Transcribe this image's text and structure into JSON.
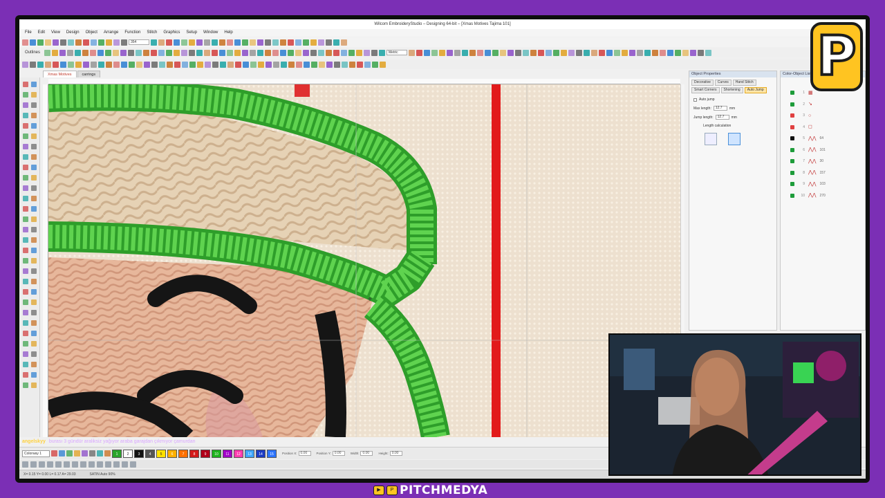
{
  "window": {
    "title": "Wilcom EmbroideryStudio – Designing 64-bit – [Xmas Motives   Tajima 101]"
  },
  "menu": [
    "File",
    "Edit",
    "View",
    "Design",
    "Object",
    "Arrange",
    "Function",
    "Stitch",
    "Graphics",
    "Setup",
    "Window",
    "Help"
  ],
  "toolbar": {
    "outlines_label": "Outlines",
    "zoom_value": "354",
    "units_value": "Metric"
  },
  "doc_tabs": [
    {
      "label": "Xmas Motives",
      "active": true
    },
    {
      "label": "carrings",
      "active": false
    }
  ],
  "object_properties": {
    "title": "Object Properties",
    "tabs": [
      "Decorative",
      "Curves",
      "Hand Stitch",
      "Smart Corners",
      "Shortening",
      "Auto Jump"
    ],
    "active_tab": "Auto Jump",
    "auto_jump_label": "Auto jump",
    "max_length_label": "Max length:",
    "max_length_value": "12.7",
    "jump_length_label": "Jump length:",
    "jump_length_value": "12.7",
    "unit": "mm",
    "length_calculation_label": "Length calculation"
  },
  "color_objects": {
    "title": "Color-Object List",
    "rows": [
      {
        "num": "1",
        "icon": "square-icon",
        "color": "#1e9c3a",
        "value": ""
      },
      {
        "num": "2",
        "icon": "pointer-icon",
        "color": "#1e9c3a",
        "value": ""
      },
      {
        "num": "3",
        "icon": "circle-icon",
        "color": "#e04040",
        "value": ""
      },
      {
        "num": "4",
        "icon": "outline-icon",
        "color": "#e04040",
        "value": ""
      },
      {
        "num": "5",
        "icon": "stitch-icon",
        "color": "#111111",
        "value": "64"
      },
      {
        "num": "6",
        "icon": "stitch-icon",
        "color": "#1e9c3a",
        "value": "101"
      },
      {
        "num": "7",
        "icon": "stitch-icon",
        "color": "#1e9c3a",
        "value": "30"
      },
      {
        "num": "8",
        "icon": "stitch-icon",
        "color": "#1e9c3a",
        "value": "157"
      },
      {
        "num": "9",
        "icon": "stitch-icon",
        "color": "#1e9c3a",
        "value": "103"
      },
      {
        "num": "10",
        "icon": "stitch-icon",
        "color": "#1e9c3a",
        "value": "270"
      }
    ]
  },
  "chat": {
    "user": "angelskyy",
    "message": "burası 3 gündür araliksiz yağıyor araba garajdan çıkmıyor çamurdan"
  },
  "bottom": {
    "colorway": "Colorway 1",
    "palette": [
      {
        "num": "1",
        "color": "#2aa52a"
      },
      {
        "num": "2",
        "color": "#ffffff"
      },
      {
        "num": "3",
        "color": "#111111"
      },
      {
        "num": "4",
        "color": "#555555"
      },
      {
        "num": "5",
        "color": "#ffe100"
      },
      {
        "num": "6",
        "color": "#ffb000"
      },
      {
        "num": "7",
        "color": "#ff7000"
      },
      {
        "num": "8",
        "color": "#d41c1c"
      },
      {
        "num": "9",
        "color": "#b0001a"
      },
      {
        "num": "10",
        "color": "#1db31d"
      },
      {
        "num": "11",
        "color": "#a000c8"
      },
      {
        "num": "12",
        "color": "#ff3cae"
      },
      {
        "num": "13",
        "color": "#3fa6ff"
      },
      {
        "num": "14",
        "color": "#1c3cc4"
      },
      {
        "num": "15",
        "color": "#2c74ff"
      }
    ],
    "position_x_label": "Position X:",
    "position_x_value": "0.00",
    "position_y_label": "Position Y:",
    "position_y_value": "0.00",
    "width_label": "Width:",
    "width_value": "0.00",
    "height_label": "Height:",
    "height_value": "0.00"
  },
  "status": {
    "coords": "X= 0.15  Y= 0.00  L= 0.17  A= 29.03",
    "mode": "SATIN  Auto 90%"
  },
  "branding": {
    "channel": "PITCHMEDYA",
    "logo_letter": "P"
  },
  "colors": {
    "frame": "#7b2fb5",
    "accent_yellow": "#ffc421",
    "stitch_green": "#3ec23a",
    "needle_red": "#e21b1b"
  }
}
